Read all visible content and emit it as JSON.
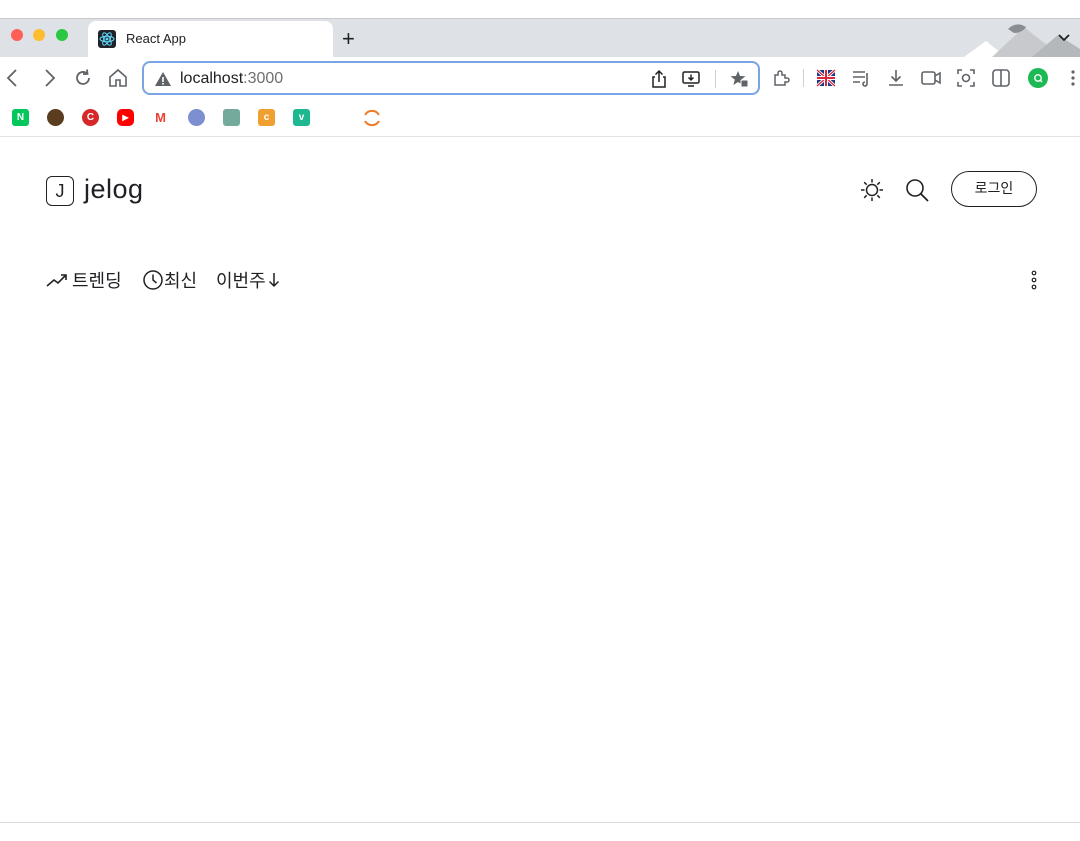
{
  "browser": {
    "tab": {
      "title": "React App",
      "favicon": "react-icon"
    },
    "new_tab_label": "+",
    "address": {
      "host": "localhost",
      "port": ":3000"
    },
    "bookmarks": [
      {
        "icon": "naver-icon",
        "letter": "N",
        "color": "#03c75a"
      },
      {
        "icon": "hex-icon",
        "letter": "",
        "color": "#5a3d1e"
      },
      {
        "icon": "c-red-icon",
        "letter": "C",
        "color": "#d62828"
      },
      {
        "icon": "youtube-icon",
        "letter": "▶",
        "color": "#ff0000"
      },
      {
        "icon": "gmail-icon",
        "letter": "M",
        "color": "#ea4335"
      },
      {
        "icon": "disc-icon",
        "letter": "",
        "color": "#7b8fd1"
      },
      {
        "icon": "chatgpt-icon",
        "letter": "",
        "color": "#74aa9c"
      },
      {
        "icon": "c-orange-icon",
        "letter": "c",
        "color": "#f0a030"
      },
      {
        "icon": "v-icon",
        "letter": "v",
        "color": "#1db88f"
      },
      {
        "icon": "loading-icon",
        "letter": "",
        "color": "#f07a2a"
      }
    ]
  },
  "page": {
    "logo_letter": "J",
    "title": "jelog",
    "login_label": "로그인",
    "filters": [
      {
        "label": "트렌딩",
        "icon": "trending-icon"
      },
      {
        "label": "최신",
        "icon": "clock-icon"
      },
      {
        "label": "이번주",
        "icon": "chevron-down-icon"
      }
    ]
  }
}
